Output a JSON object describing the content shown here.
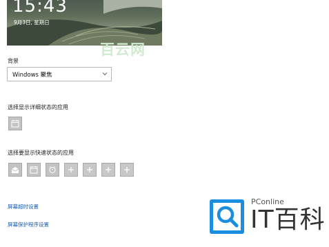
{
  "lock_preview": {
    "time": "15:43",
    "date": "9月3日, 星期日"
  },
  "watermark": "百云网",
  "background": {
    "label": "背景",
    "selected": "Windows 聚焦"
  },
  "detailed_status": {
    "label": "选择显示详细状态的应用"
  },
  "quick_status": {
    "label": "选择要显示快速状态的应用"
  },
  "links": {
    "screen_timeout": "屏幕超时设置",
    "screensaver": "屏幕保护程序设置"
  },
  "logo": {
    "brand": "PConline",
    "name": "IT百科"
  },
  "colors": {
    "link": "#1d5fae",
    "logo_blue": "#1c8ee0",
    "tile": "#c3c3c3"
  }
}
